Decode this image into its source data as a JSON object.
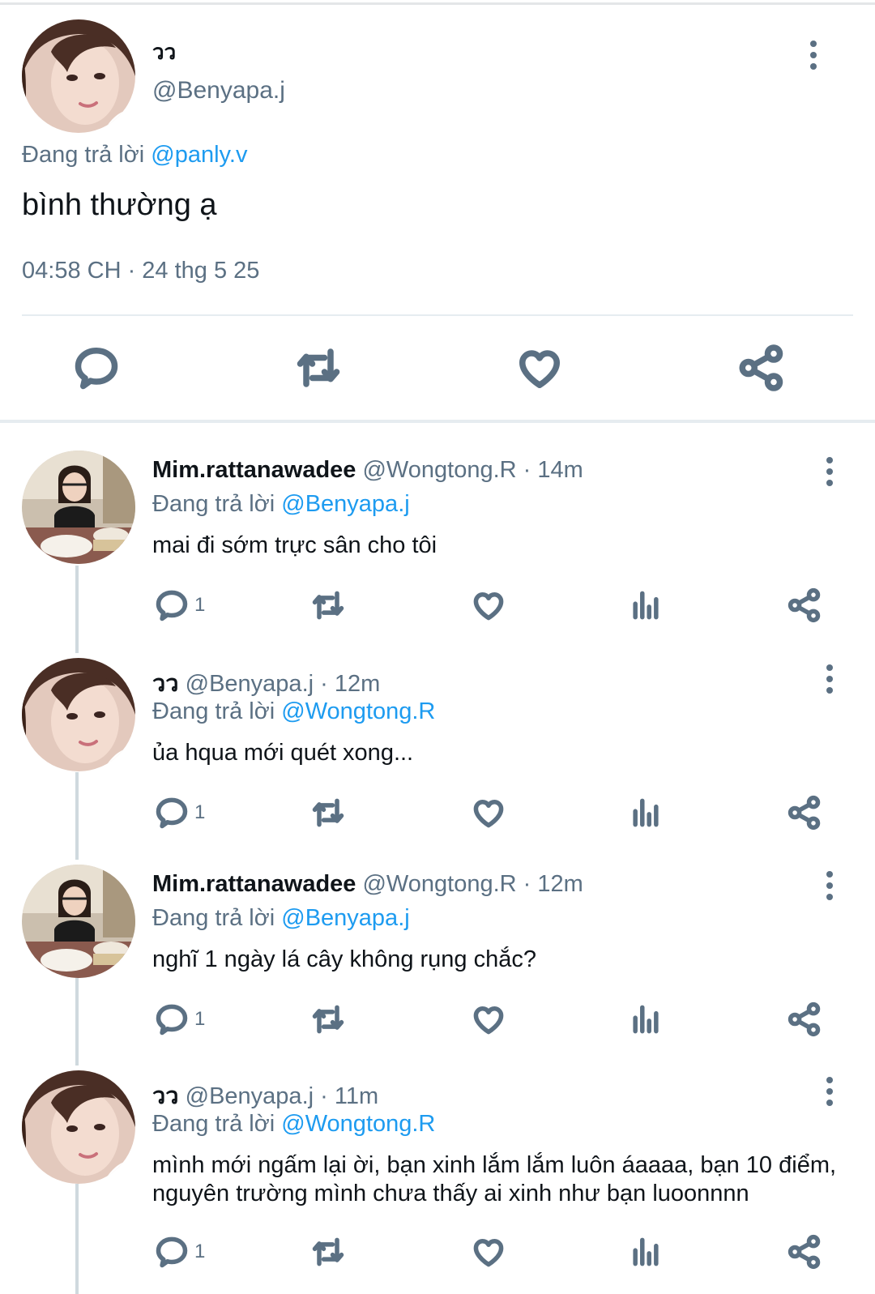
{
  "main_tweet": {
    "display_name": "วว",
    "handle": "@Benyapa.j",
    "replying_label": "Đang trả lời",
    "replying_to": "@panly.v",
    "text": "bình thường ạ",
    "timestamp": "04:58 CH · 24 thg 5 25"
  },
  "replies": [
    {
      "display_name": "Mim.rattanawadee",
      "handle": "@Wongtong.R",
      "time": "· 14m",
      "replying_label": "Đang trả lời",
      "replying_to": "@Benyapa.j",
      "text": "mai đi sớm trực sân cho tôi",
      "reply_count": "1"
    },
    {
      "display_name": "วว",
      "handle": "@Benyapa.j",
      "time": "· 12m",
      "replying_label": "Đang trả lời",
      "replying_to": "@Wongtong.R",
      "text": "ủa hqua mới quét xong...",
      "reply_count": "1"
    },
    {
      "display_name": "Mim.rattanawadee",
      "handle": "@Wongtong.R",
      "time": "· 12m",
      "replying_label": "Đang trả lời",
      "replying_to": "@Benyapa.j",
      "text": "nghĩ 1 ngày lá cây không rụng chắc?",
      "reply_count": "1"
    },
    {
      "display_name": "วว",
      "handle": "@Benyapa.j",
      "time": "· 11m",
      "replying_label": "Đang trả lời",
      "replying_to": "@Wongtong.R",
      "text": "mình mới ngấm lại ời, bạn xinh lắm lắm luôn áaaaa, bạn 10 điểm, nguyên trường mình chưa thấy ai xinh như bạn luoonnnn",
      "reply_count": "1"
    }
  ],
  "colors": {
    "link": "#1d9bf0",
    "secondary_text": "#5b7083",
    "divider": "#e6ecf0"
  },
  "icons": [
    "more-options-icon",
    "reply-icon",
    "retweet-icon",
    "like-icon",
    "views-icon",
    "share-icon"
  ]
}
